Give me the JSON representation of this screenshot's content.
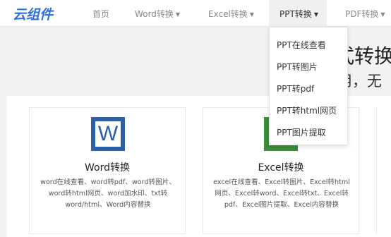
{
  "logo": "云组件",
  "nav": {
    "home": "首页",
    "word": "Word转换",
    "excel": "Excel转换",
    "ppt": "PPT转换",
    "pdf": "PDF转换",
    "caret": "▼"
  },
  "hero": {
    "line1": "式转换",
    "line2": "用，无"
  },
  "ppt_dropdown": [
    "PPT在线查看",
    "PPT转图片",
    "PPT转pdf",
    "PPT转html网页",
    "PPT图片提取"
  ],
  "cards": {
    "word": {
      "icon_letter": "W",
      "title": "Word转换",
      "desc": "word在线查看、word转pdf、word转图片、word转html网页、word加水印、txt转word/html、Word内容替换"
    },
    "excel": {
      "title": "Excel转换",
      "desc": "excel在线查看、Excel转图片、Excel转html网页、Excel转word、Excel转txt、Excel转pdf、Excel图片提取、Excel内容替换"
    }
  },
  "colors": {
    "brand": "#2f6fd8",
    "word_icon": "#2b5fa8",
    "excel_icon": "#3c8c3a"
  }
}
